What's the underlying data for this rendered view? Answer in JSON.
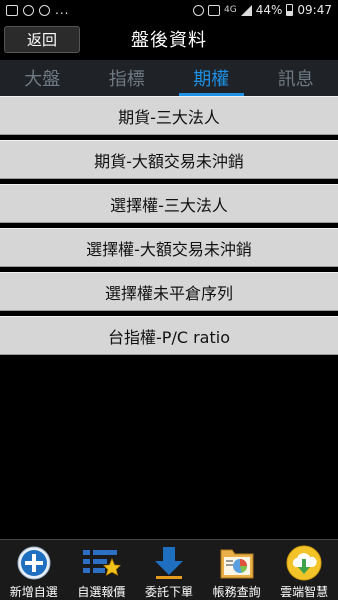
{
  "status_bar": {
    "battery": "44%",
    "time": "09:47",
    "network": "4G"
  },
  "title_bar": {
    "back_label": "返回",
    "title": "盤後資料"
  },
  "tabs": [
    {
      "label": "大盤",
      "active": false
    },
    {
      "label": "指標",
      "active": false
    },
    {
      "label": "期權",
      "active": true
    },
    {
      "label": "訊息",
      "active": false
    }
  ],
  "menu": [
    {
      "label": "期貨-三大法人"
    },
    {
      "label": "期貨-大額交易未沖銷"
    },
    {
      "label": "選擇權-三大法人"
    },
    {
      "label": "選擇權-大額交易未沖銷"
    },
    {
      "label": "選擇權未平倉序列"
    },
    {
      "label": "台指權-P/C ratio"
    }
  ],
  "bottom_nav": [
    {
      "label": "新增自選",
      "icon": "add-icon"
    },
    {
      "label": "自選報價",
      "icon": "list-star-icon"
    },
    {
      "label": "委託下單",
      "icon": "download-arrow-icon"
    },
    {
      "label": "帳務查詢",
      "icon": "folder-chart-icon"
    },
    {
      "label": "雲端智慧",
      "icon": "cloud-download-icon"
    }
  ],
  "colors": {
    "accent": "#1e90e6",
    "tab_inactive": "#6f7a84",
    "menu_bg": "#d6d6d6"
  }
}
